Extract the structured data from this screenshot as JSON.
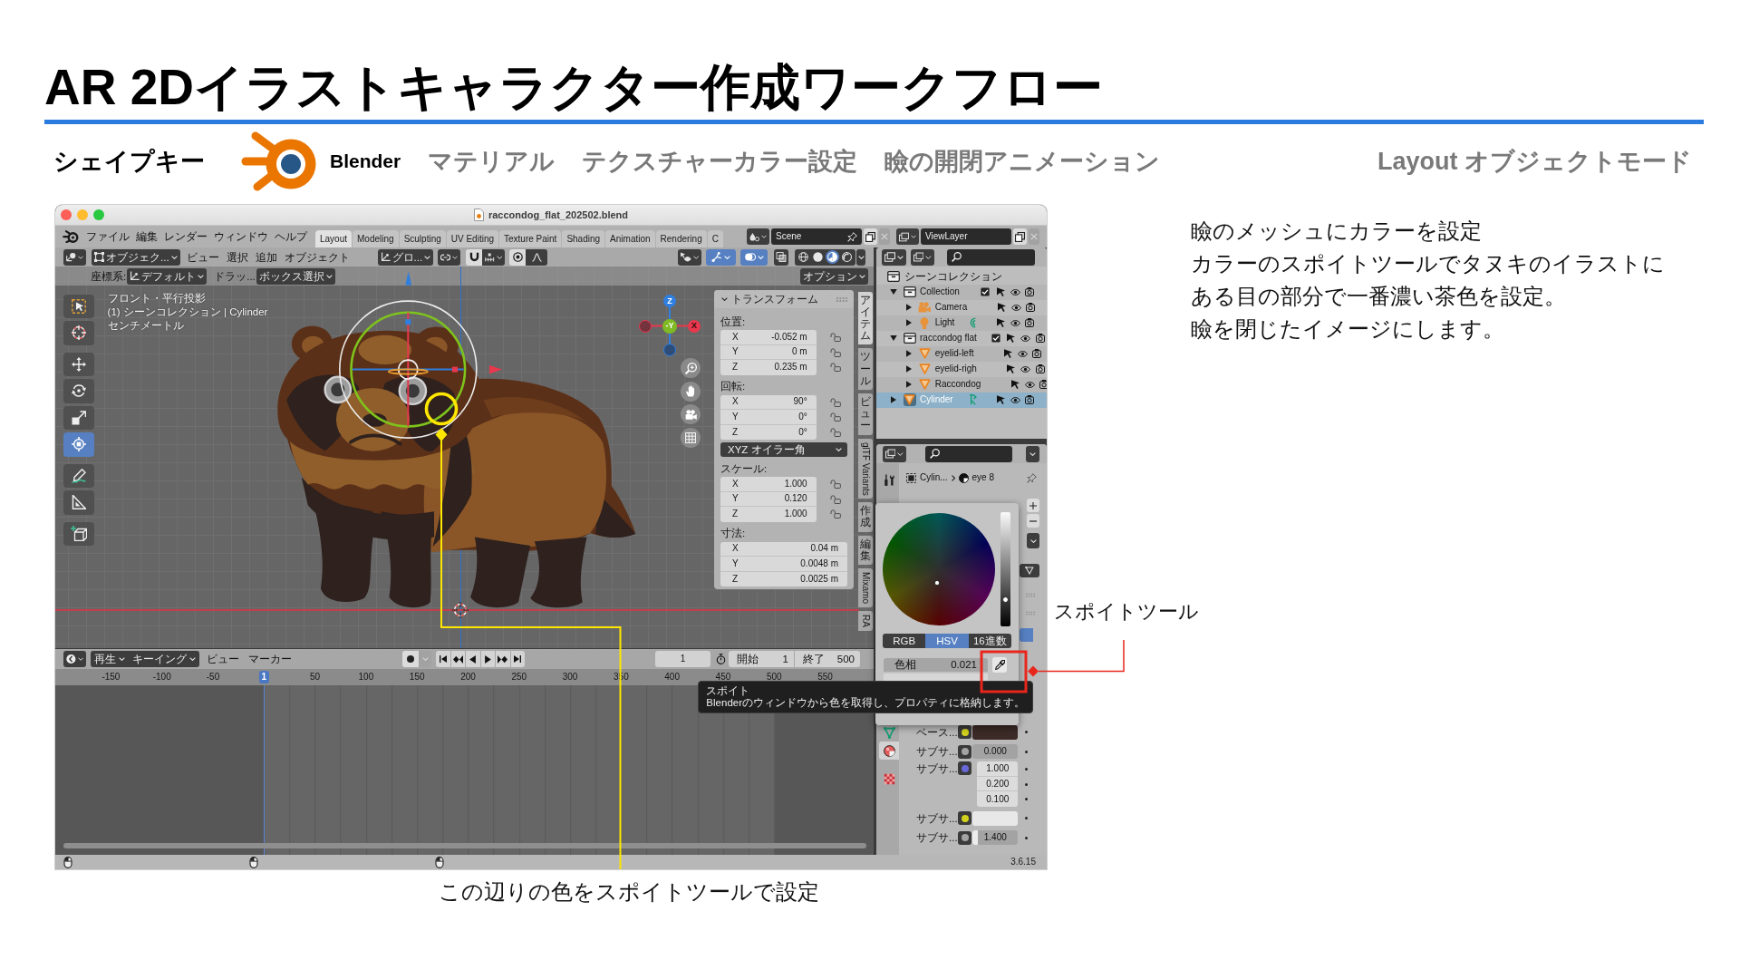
{
  "slide": {
    "title": "AR 2Dイラストキャラクター作成ワークフロー"
  },
  "nav": {
    "section": "シェイプキー",
    "steps": [
      {
        "label": "Blender",
        "kind": "app",
        "selected": true
      },
      {
        "label": "マテリアル",
        "kind": "step",
        "selected": false
      },
      {
        "label": "テクスチャーカラー設定",
        "kind": "step",
        "selected": false
      },
      {
        "label": "瞼の開閉アニメーション",
        "kind": "step",
        "selected": false
      }
    ],
    "mode": "Layout オブジェクトモード"
  },
  "blender": {
    "file_name": "raccondog_flat_202502.blend",
    "menus": [
      "ファイル",
      "編集",
      "レンダー",
      "ウィンドウ",
      "ヘルプ"
    ],
    "workspaces": [
      {
        "label": "Layout",
        "selected": true
      },
      {
        "label": "Modeling",
        "selected": false
      },
      {
        "label": "Sculpting",
        "selected": false
      },
      {
        "label": "UV Editing",
        "selected": false
      },
      {
        "label": "Texture Paint",
        "selected": false
      },
      {
        "label": "Shading",
        "selected": false
      },
      {
        "label": "Animation",
        "selected": false
      },
      {
        "label": "Rendering",
        "selected": false
      },
      {
        "label": "C",
        "selected": false
      }
    ],
    "scene": "Scene",
    "view_layer": "ViewLayer",
    "viewport_header": {
      "mode": "オブジェク...",
      "menus": [
        "ビュー",
        "選択",
        "追加",
        "オブジェクト"
      ],
      "orientation": "グロ...",
      "toggles": [
        {
          "kind": "gizmo",
          "on": true
        },
        {
          "kind": "overlay",
          "on": true
        },
        {
          "kind": "xray",
          "on": false
        }
      ],
      "shading": [
        {
          "kind": "wireframe",
          "selected": false
        },
        {
          "kind": "solid",
          "selected": false
        },
        {
          "kind": "material",
          "selected": true
        },
        {
          "kind": "rendered",
          "selected": false
        }
      ]
    },
    "tool_settings": {
      "orientation_label": "座標系:",
      "orientation": "デフォルト",
      "drag_label": "ドラッ...",
      "select_mode": "ボックス選択",
      "options": "オプション"
    },
    "viewport": {
      "info": [
        "フロント・平行投影",
        "(1) シーンコレクション | Cylinder",
        "センチメートル"
      ],
      "tools": [
        {
          "kind": "select",
          "selected": false
        },
        {
          "kind": "cursor",
          "selected": false
        },
        {
          "kind": "move",
          "selected": false
        },
        {
          "kind": "rotate",
          "selected": false
        },
        {
          "kind": "scale",
          "selected": false
        },
        {
          "kind": "transform",
          "selected": true
        },
        {
          "kind": "annotate",
          "selected": false
        },
        {
          "kind": "measure",
          "selected": false
        },
        {
          "kind": "add",
          "selected": false
        }
      ],
      "axes": [
        {
          "label": "Z",
          "kind": "z",
          "color": "#2f7fe0"
        },
        {
          "label": "-Y",
          "kind": "y",
          "color": "#7fb924"
        },
        {
          "label": "X",
          "kind": "x",
          "color": "#e8384d"
        }
      ],
      "side_tabs": [
        {
          "label": "アイテム",
          "kind": "cjk",
          "selected": true
        },
        {
          "label": "ツール",
          "kind": "cjk",
          "selected": false
        },
        {
          "label": "ビュー",
          "kind": "cjk",
          "selected": false
        },
        {
          "label": "glTF Variants",
          "kind": "latin",
          "selected": false
        },
        {
          "label": "作成",
          "kind": "cjk",
          "selected": false
        },
        {
          "label": "編集",
          "kind": "cjk",
          "selected": false
        },
        {
          "label": "Mixamo",
          "kind": "latin",
          "selected": false
        },
        {
          "label": "RA",
          "kind": "latin",
          "selected": false
        }
      ]
    },
    "transform": {
      "title": "トランスフォーム",
      "items": [
        {
          "kind": "group",
          "label": "位置:",
          "rows": [
            {
              "axis": "X",
              "value": "-0.052 m",
              "locked": false
            },
            {
              "axis": "Y",
              "value": "0 m",
              "locked": false
            },
            {
              "axis": "Z",
              "value": "0.235 m",
              "locked": false
            }
          ]
        },
        {
          "kind": "group",
          "label": "回転:",
          "rows": [
            {
              "axis": "X",
              "value": "90°",
              "locked": false
            },
            {
              "axis": "Y",
              "value": "0°",
              "locked": false
            },
            {
              "axis": "Z",
              "value": "0°",
              "locked": false
            }
          ]
        },
        {
          "kind": "dropdown",
          "label": "XYZ オイラー角"
        },
        {
          "kind": "group",
          "label": "スケール:",
          "rows": [
            {
              "axis": "X",
              "value": "1.000",
              "locked": false
            },
            {
              "axis": "Y",
              "value": "0.120",
              "locked": false
            },
            {
              "axis": "Z",
              "value": "1.000",
              "locked": false
            }
          ]
        },
        {
          "kind": "group",
          "label": "寸法:",
          "rows": [
            {
              "axis": "X",
              "value": "0.04 m"
            },
            {
              "axis": "Y",
              "value": "0.0048 m"
            },
            {
              "axis": "Z",
              "value": "0.0025 m"
            }
          ]
        }
      ]
    },
    "outliner": {
      "root": "シーンコレクション",
      "items": [
        {
          "label": "Collection",
          "kind": "collection",
          "expanded": true,
          "checked": true,
          "selected": false,
          "children": [
            {
              "label": "Camera",
              "kind": "camera",
              "expanded": false,
              "selected": false,
              "linked_data": false
            },
            {
              "label": "Light",
              "kind": "light",
              "expanded": false,
              "selected": false,
              "linked_data": true
            }
          ]
        },
        {
          "label": "raccondog flat",
          "kind": "collection",
          "expanded": true,
          "checked": true,
          "selected": false,
          "children": [
            {
              "label": "eyelid-left",
              "kind": "mesh",
              "expanded": false,
              "selected": false,
              "linked_data": false
            },
            {
              "label": "eyelid-righ",
              "kind": "mesh",
              "expanded": false,
              "selected": false,
              "linked_data": false
            },
            {
              "label": "Raccondog",
              "kind": "mesh",
              "expanded": false,
              "selected": false,
              "linked_data": false
            }
          ]
        },
        {
          "label": "Cylinder",
          "kind": "mesh",
          "expanded": false,
          "selected": true,
          "linked_data": true
        }
      ]
    },
    "properties": {
      "tabs": [
        {
          "kind": "tool",
          "selected": false
        },
        {
          "kind": "data",
          "selected": false
        },
        {
          "kind": "material",
          "selected": true
        },
        {
          "kind": "texture",
          "selected": false
        }
      ],
      "breadcrumb": [
        {
          "label": "Cylin...",
          "kind": "object"
        },
        {
          "label": "eye 8",
          "kind": "material"
        }
      ],
      "color_picker": {
        "value_slider": {
          "level": 0.225
        },
        "modes": [
          {
            "label": "RGB",
            "selected": false
          },
          {
            "label": "HSV",
            "selected": true
          },
          {
            "label": "16進数",
            "selected": false
          }
        ],
        "fields": [
          {
            "label": "色相",
            "value": "0.021"
          }
        ]
      },
      "tooltip": {
        "title": "スポイト",
        "text": "Blenderのウィンドウから色を取得し、プロパティに格納します。"
      },
      "inputs": [
        {
          "label": "ベース...",
          "kind": "color",
          "color": "#d2d21e",
          "swatch": {
            "color": "#3b2a26"
          }
        },
        {
          "label": "サブサ...",
          "kind": "number",
          "color": "#a3a3a3",
          "value": "0.000"
        },
        {
          "label": "サブサ...",
          "kind": "vector",
          "color": "#6868d8",
          "values": [
            "1.000",
            "0.200",
            "0.100"
          ]
        },
        {
          "label": "サブサ...",
          "kind": "color",
          "color": "#d2d21e",
          "swatch": {
            "color": "#e8e8e8"
          }
        },
        {
          "label": "サブサ...",
          "kind": "number",
          "color": "#a3a3a3",
          "value": "1.400",
          "level": 0.11
        }
      ]
    },
    "timeline": {
      "menus": [
        {
          "label": "再生",
          "kind": "dropdown"
        },
        {
          "label": "キーイング",
          "kind": "dropdown"
        },
        {
          "label": "ビュー",
          "kind": "menu"
        },
        {
          "label": "マーカー",
          "kind": "menu"
        }
      ],
      "current_frame": "1",
      "start": {
        "label": "開始",
        "value": "1"
      },
      "end": {
        "label": "終了",
        "value": "500"
      },
      "ruler": [
        {
          "label": "-150",
          "selected": false
        },
        {
          "label": "-100",
          "selected": false
        },
        {
          "label": "-50",
          "selected": false
        },
        {
          "label": "1",
          "selected": true
        },
        {
          "label": "50",
          "selected": false
        },
        {
          "label": "100",
          "selected": false
        },
        {
          "label": "150",
          "selected": false
        },
        {
          "label": "200",
          "selected": false
        },
        {
          "label": "250",
          "selected": false
        },
        {
          "label": "300",
          "selected": false
        },
        {
          "label": "350",
          "selected": false
        },
        {
          "label": "400",
          "selected": false
        },
        {
          "label": "450",
          "selected": false
        },
        {
          "label": "500",
          "selected": false
        },
        {
          "label": "550",
          "selected": false
        }
      ]
    },
    "version": "3.6.15"
  },
  "notes": [
    "瞼のメッシュにカラーを設定",
    "カラーのスポイトツールでタヌキのイラストに",
    "ある目の部分で一番濃い茶色を設定。",
    "瞼を閉じたイメージにします。"
  ],
  "callout": "スポイトツール",
  "caption": "この辺りの色をスポイトツールで設定"
}
